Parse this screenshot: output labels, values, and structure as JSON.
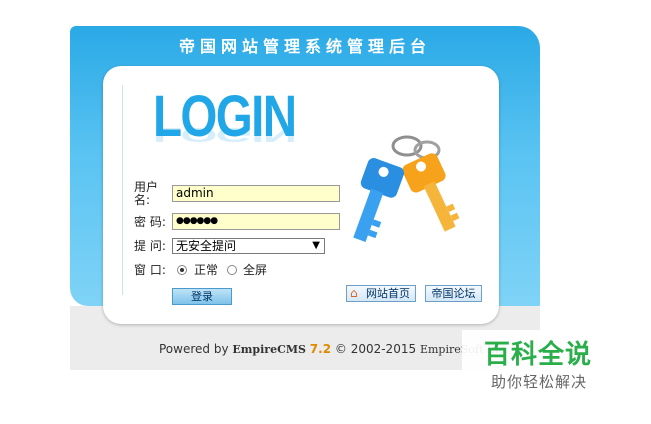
{
  "header": {
    "title": "帝国网站管理系统管理后台"
  },
  "login_heading": "LOGIN",
  "form": {
    "username_label": "用户名:",
    "username_value": "admin",
    "password_label": "密 码:",
    "password_value": "●●●●●●",
    "question_label": "提 问:",
    "question_value": "无安全提问",
    "window_label": "窗 口:",
    "window_options": [
      {
        "label": "正常",
        "selected": true
      },
      {
        "label": "全屏",
        "selected": false
      }
    ],
    "submit_label": "登录"
  },
  "links": {
    "site_home": "网站首页",
    "forum": "帝国论坛"
  },
  "footer": {
    "powered_by": "Powered by",
    "product": "EmpireCMS",
    "version": "7.2",
    "copyright": "© 2002-2015",
    "company": "EmpireSoft Inc."
  },
  "watermark": {
    "title": "百科全说",
    "subtitle": "助你轻松解决"
  },
  "icons": [
    "keys-icon",
    "home-icon",
    "dropdown-arrow-icon"
  ],
  "colors": {
    "frame_blue": "#2aa9e6",
    "login_blue": "#21a7e8",
    "input_yellow": "#ffffcc",
    "version_orange": "#e08a00",
    "watermark_green": "#2aae4a"
  }
}
